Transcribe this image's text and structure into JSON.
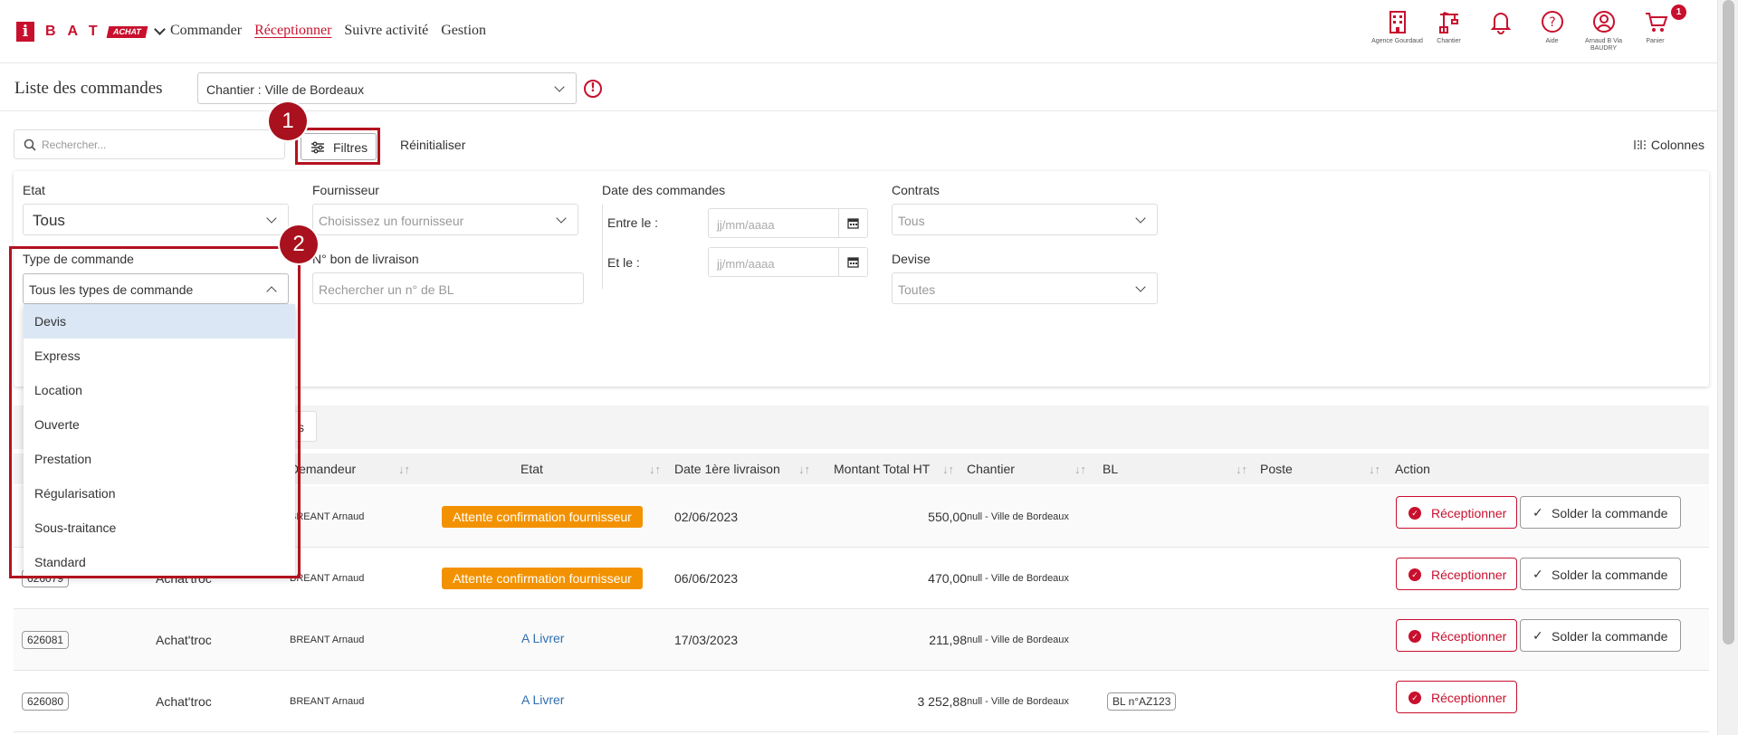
{
  "brand": {
    "logo_i": "i",
    "logo_letters": "BAT",
    "logo_badge": "ACHAT",
    "accent": "#c8102e"
  },
  "nav": {
    "items": [
      {
        "label": "Commander",
        "active": false
      },
      {
        "label": "Réceptionner",
        "active": true
      },
      {
        "label": "Suivre activité",
        "active": false
      },
      {
        "label": "Gestion",
        "active": false
      }
    ]
  },
  "toolbar": {
    "agence_label": "Agence Gourdaud",
    "chantier_label": "Chantier",
    "aide_label": "Aide",
    "user_label": "Arnaud B Via BAUDRY",
    "panier_label": "Panier",
    "cart_count": "1",
    "icons": [
      "building-icon",
      "crane-icon",
      "bell-icon",
      "help-icon",
      "user-icon",
      "cart-icon"
    ]
  },
  "header": {
    "title": "Liste des commandes",
    "site_select_value": "Chantier : Ville de Bordeaux"
  },
  "filters": {
    "search_placeholder": "Rechercher...",
    "filtres_label": "Filtres",
    "reset_label": "Réinitialiser",
    "colonnes_label": "Colonnes",
    "etat_label": "Etat",
    "etat_value": "Tous",
    "fournisseur_label": "Fournisseur",
    "fournisseur_placeholder": "Choisissez un fournisseur",
    "date_label": "Date des commandes",
    "entre_label": "Entre le :",
    "et_label": "Et le :",
    "date_placeholder": "jj/mm/aaaa",
    "contrats_label": "Contrats",
    "contrats_value": "Tous",
    "type_label": "Type de commande",
    "type_value": "Tous les types de commande",
    "bl_label": "N° bon de livraison",
    "bl_placeholder": "Rechercher un n° de BL",
    "devise_label": "Devise",
    "devise_value": "Toutes"
  },
  "dropdown": {
    "options": [
      "Devis",
      "Express",
      "Location",
      "Ouverte",
      "Prestation",
      "Régularisation",
      "Sous-traitance",
      "Standard"
    ],
    "selected": "Devis"
  },
  "annotations": {
    "step1": "1",
    "step2": "2",
    "color": "#b3121f"
  },
  "tabs": {
    "partial_label": "s"
  },
  "table": {
    "columns": {
      "demandeur": "Demandeur",
      "etat": "Etat",
      "date": "Date 1ère livraison",
      "montant": "Montant Total HT",
      "chantier": "Chantier",
      "bl": "BL",
      "poste": "Poste",
      "action": "Action"
    },
    "rows": [
      {
        "id": "",
        "type": "",
        "demandeur": "BREANT Arnaud",
        "etat": "Attente confirmation fournisseur",
        "etat_style": "orange",
        "date": "02/06/2023",
        "montant": "550,00",
        "chantier": "null - Ville de Bordeaux",
        "bl": "",
        "solder": true
      },
      {
        "id": "626079",
        "type": "Achat'troc",
        "demandeur": "BREANT Arnaud",
        "etat": "Attente confirmation fournisseur",
        "etat_style": "orange",
        "date": "06/06/2023",
        "montant": "470,00",
        "chantier": "null - Ville de Bordeaux",
        "bl": "",
        "solder": true
      },
      {
        "id": "626081",
        "type": "Achat'troc",
        "demandeur": "BREANT Arnaud",
        "etat": "A Livrer",
        "etat_style": "blue",
        "date": "17/03/2023",
        "montant": "211,98",
        "chantier": "null - Ville de Bordeaux",
        "bl": "",
        "solder": true
      },
      {
        "id": "626080",
        "type": "Achat'troc",
        "demandeur": "BREANT Arnaud",
        "etat": "A Livrer",
        "etat_style": "blue",
        "date": "",
        "montant": "3 252,88",
        "chantier": "null - Ville de Bordeaux",
        "bl": "BL n°AZ123",
        "solder": false
      }
    ],
    "receptionner_label": "Réceptionner",
    "solder_label": "Solder la commande"
  }
}
